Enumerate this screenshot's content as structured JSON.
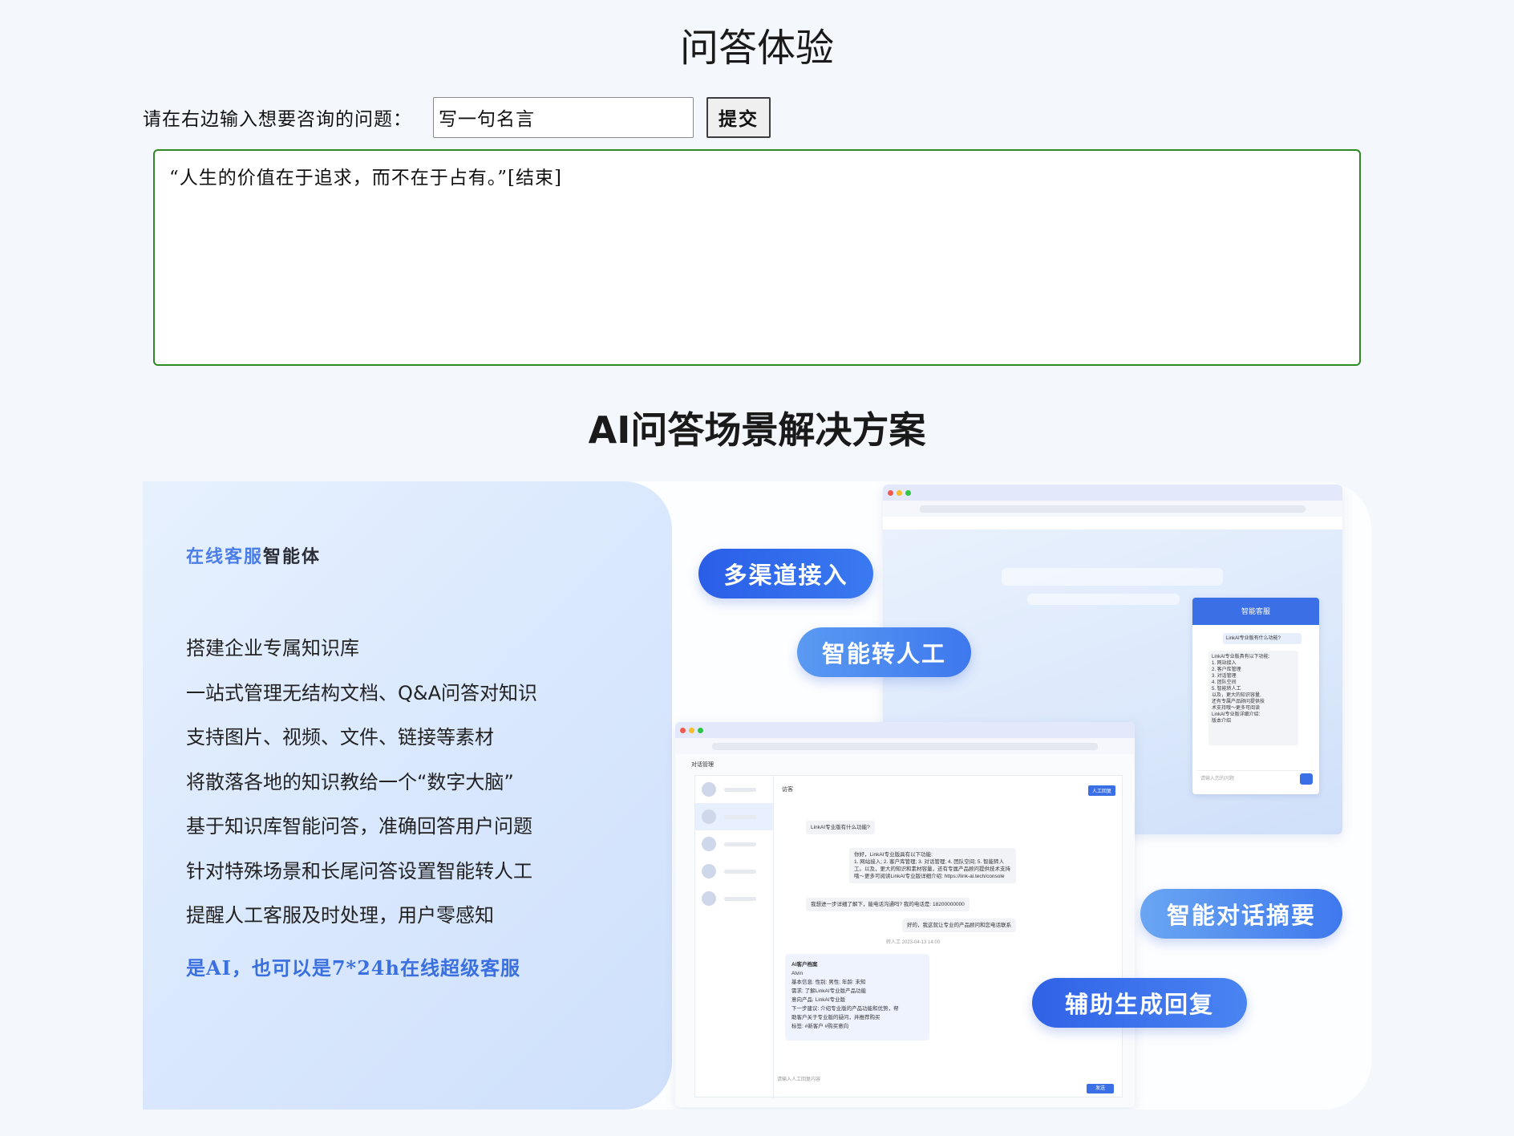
{
  "page": {
    "title": "问答体验"
  },
  "ask": {
    "label": "请在右边输入想要咨询的问题：",
    "input_value": "写一句名言",
    "submit_label": "提交"
  },
  "answer": {
    "text": "“人生的价值在于追求，而不在于占有。”[结束]"
  },
  "solutions": {
    "title": "AI问答场景解决方案",
    "card_title_highlight": "在线客服",
    "card_title_rest": "智能体",
    "features": [
      "搭建企业专属知识库",
      "一站式管理无结构文档、Q&A问答对知识",
      "支持图片、视频、文件、链接等素材",
      "将散落各地的知识教给一个“数字大脑”",
      "基于知识库智能问答，准确回答用户问题",
      "针对特殊场景和长尾问答设置智能转人工",
      "提醒人工客服及时处理，用户零感知"
    ],
    "slogan": "是AI，也可以是7*24h在线超级客服",
    "pills": [
      "多渠道接入",
      "智能转人工",
      "智能对话摘要",
      "辅助生成回复"
    ]
  },
  "mockup": {
    "chat_head": "智能客服",
    "chat_question": "LinkAI专业版有什么功能?",
    "chat_answer": "LinkAI专业版具有以下功能:\n1. 网站接入\n2. 客户库管理\n3. 对话管理\n4. 团队空间\n5. 智能转人工\n以及，更大的知识容量,\n还有专属产品顾问提供技\n术支持哦～更多可阅读\nLinkAI专业版详细介绍:\n版本介绍",
    "chat_input_placeholder": "请输入您的问题",
    "crumb": "对话管理",
    "conv_title": "访客",
    "manual_tag": "人工回复",
    "q1": "LinkAI专业版有什么功能?",
    "a1": "你好，LinkAI专业版具有以下功能:\n1. 网站接入; 2. 客户库管理; 3. 对话管理; 4. 团队空间; 5. 智能转人\n工。以及，更大的知识和素材容量，还有专属产品顾问提供技术支持\n哦～更多可阅读LinkAI专业版详细介绍: https://link-ai.tech/console",
    "q2": "我想进一步详细了解下，能电话沟通吗? 我的电话是: 18200000000",
    "a2": "好的，我这就让专业的产品顾问和您电话联系",
    "transfer_note": "转人工 2023-04-13 14:00",
    "profile_title": "AI客户档案",
    "profile_name": "Alvin",
    "profile_lines": [
      "基本信息:   性别: 男性;  年龄: 未知",
      "需求:   了解LinkAI专业版产品功能",
      "意向产品:   LinkAI专业版",
      "下一步建议:   介绍专业版的产品功能和优势，帮",
      "助客户关于专业版的疑问，并推荐购买",
      "标签:   #新客户 #购买意向"
    ],
    "input_placeholder": "请输入人工回复内容",
    "send_label": "发送"
  },
  "colors": {
    "accent": "#3b6fe6",
    "answer_border": "#2d8a24"
  }
}
